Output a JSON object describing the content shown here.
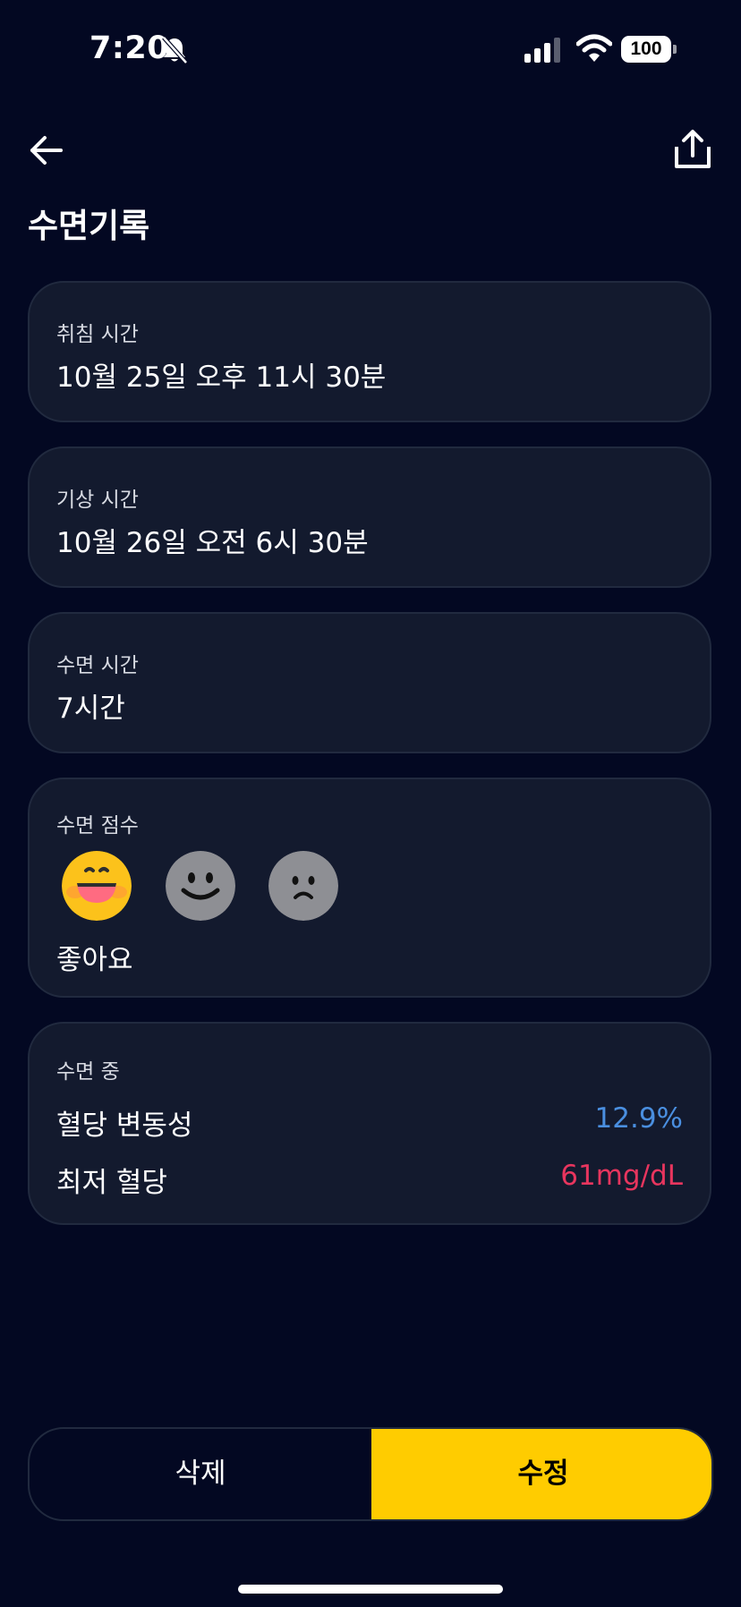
{
  "status_bar": {
    "time": "7:20",
    "battery": "100"
  },
  "header": {
    "title": "수면기록"
  },
  "cards": {
    "bedtime": {
      "label": "취침 시간",
      "value": "10월 25일 오후 11시 30분"
    },
    "wake_time": {
      "label": "기상 시간",
      "value": "10월 26일 오전 6시 30분"
    },
    "sleep_duration": {
      "label": "수면 시간",
      "value": "7시간"
    },
    "sleep_score": {
      "label": "수면 점수",
      "options": [
        "good-face-icon",
        "neutral-face-icon",
        "sad-face-icon"
      ],
      "selected_label": "좋아요"
    },
    "during_sleep": {
      "label": "수면 중",
      "metrics": [
        {
          "label": "혈당 변동성",
          "value": "12.9%",
          "color": "#4a8fe0"
        },
        {
          "label": "최저 혈당",
          "value": "61mg/dL",
          "color": "#e8355e"
        }
      ]
    }
  },
  "actions": {
    "delete_label": "삭제",
    "edit_label": "수정"
  },
  "colors": {
    "background": "#030822",
    "card": "#131a2e",
    "accent": "#ffcc00"
  }
}
